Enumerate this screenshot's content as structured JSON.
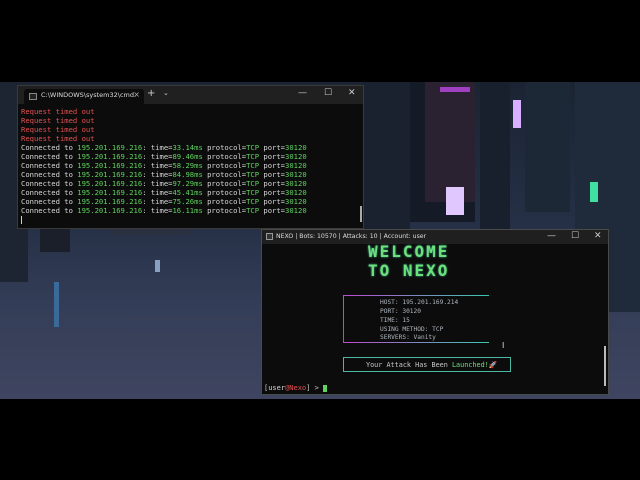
{
  "cmd": {
    "tab_title": "C:\\WINDOWS\\system32\\cmd.",
    "tab_close": "×",
    "new_tab": "+",
    "dropdown": "⌄",
    "minimize": "—",
    "maximize": "☐",
    "close": "✕",
    "timeouts": [
      "Request timed out",
      "Request timed out",
      "Request timed out",
      "Request timed out"
    ],
    "connections": [
      {
        "prefix": "Connected to ",
        "ip": "195.201.169.216",
        "time": "33.14ms",
        "protocol": "TCP",
        "port": "30120"
      },
      {
        "prefix": "Connected to ",
        "ip": "195.201.169.216",
        "time": "89.46ms",
        "protocol": "TCP",
        "port": "30120"
      },
      {
        "prefix": "Connected to ",
        "ip": "195.201.169.216",
        "time": "58.29ms",
        "protocol": "TCP",
        "port": "30120"
      },
      {
        "prefix": "Connected to ",
        "ip": "195.201.169.216",
        "time": "84.98ms",
        "protocol": "TCP",
        "port": "30120"
      },
      {
        "prefix": "Connected to ",
        "ip": "195.201.169.216",
        "time": "97.29ms",
        "protocol": "TCP",
        "port": "30120"
      },
      {
        "prefix": "Connected to ",
        "ip": "195.201.169.216",
        "time": "45.41ms",
        "protocol": "TCP",
        "port": "30120"
      },
      {
        "prefix": "Connected to ",
        "ip": "195.201.169.216",
        "time": "75.26ms",
        "protocol": "TCP",
        "port": "30120"
      },
      {
        "prefix": "Connected to ",
        "ip": "195.201.169.216",
        "time": "16.11ms",
        "protocol": "TCP",
        "port": "30120"
      }
    ]
  },
  "nexo": {
    "title": "NEXO | Bots: 10570 | Attacks: 10 | Account: user",
    "minimize": "—",
    "maximize": "☐",
    "close": "✕",
    "banner_line1": "WELCOME",
    "banner_line2": "TO NEXO",
    "info": {
      "host": "HOST: 195.201.169.214",
      "port": "PORT: 30120",
      "time": "TIME: 15",
      "method": "USING METHOD: TCP",
      "servers": "SERVERS: Vanity"
    },
    "launched_prefix": "Your Attack Has Been ",
    "launched_word": "Launched!",
    "launched_icon": "🚀",
    "prompt_user": "user",
    "prompt_at": "@",
    "prompt_host": "Nexo",
    "prompt_open": "[",
    "prompt_close": "]",
    "prompt_arrow": " > "
  },
  "colors": {
    "timeout_red": "#e45050",
    "value_green": "#5fd35f",
    "banner_green": "#6ee07a",
    "border_magenta": "#c04ad0",
    "border_teal": "#3cc7b0"
  }
}
